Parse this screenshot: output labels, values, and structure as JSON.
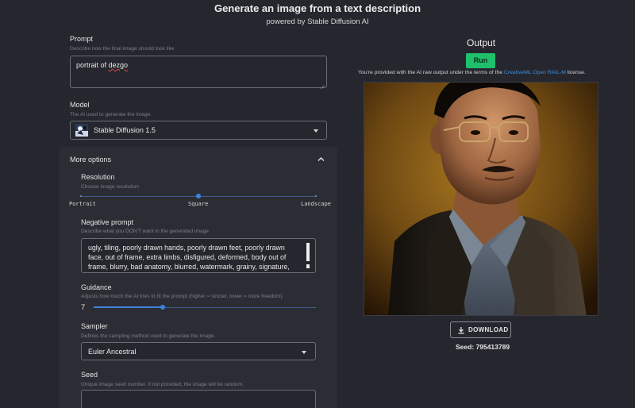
{
  "header": {
    "title": "Generate an image from a text description",
    "subtitle": "powered by Stable Diffusion AI"
  },
  "prompt": {
    "label": "Prompt",
    "description": "Describe how the final image should look like",
    "value_plain": "portrait of ",
    "value_flagged": "dezgo"
  },
  "model": {
    "label": "Model",
    "description": "The AI used to generate the image.",
    "value": "Stable Diffusion 1.5",
    "icon": "model-thumbnail-icon"
  },
  "more_options": {
    "label": "More options",
    "expanded": true,
    "resolution": {
      "label": "Resolution",
      "description": "Choose image resolution",
      "options": [
        "Portrait",
        "Square",
        "Landscape"
      ],
      "selected": "Square"
    },
    "negative_prompt": {
      "label": "Negative prompt",
      "description": "Describe what you DON'T want in the generated image",
      "lines": [
        "ugly, tiling, poorly drawn hands, poorly drawn feet, poorly drawn",
        "face, out of frame, extra limbs, disfigured, deformed, body out of",
        "frame, blurry, bad anatomy, blurred, watermark, grainy, signature,"
      ]
    },
    "guidance": {
      "label": "Guidance",
      "description": "Adjusts how much the AI tries to fit the prompt (higher = stricter, lower = more freedom).",
      "value": "7",
      "level": 0.31
    },
    "sampler": {
      "label": "Sampler",
      "description": "Defines the sampling method used to generate the image.",
      "value": "Euler Ancestral"
    },
    "seed": {
      "label": "Seed",
      "description": "Unique image seed number. If not provided, the image will be random.",
      "value": ""
    }
  },
  "output": {
    "title": "Output",
    "run_label": "Run",
    "license_prefix": "You're provided with the AI raw output under the terms of the ",
    "license_link": "CreativeML Open RAIL-M",
    "license_suffix": " license.",
    "download_label": "DOWNLOAD",
    "seed_text": "Seed: 795413789"
  },
  "colors": {
    "background": "#26272e",
    "panel": "#2c2d34",
    "accent": "#3d82de",
    "run_button": "#1fbf6b",
    "link": "#3b8de0"
  }
}
